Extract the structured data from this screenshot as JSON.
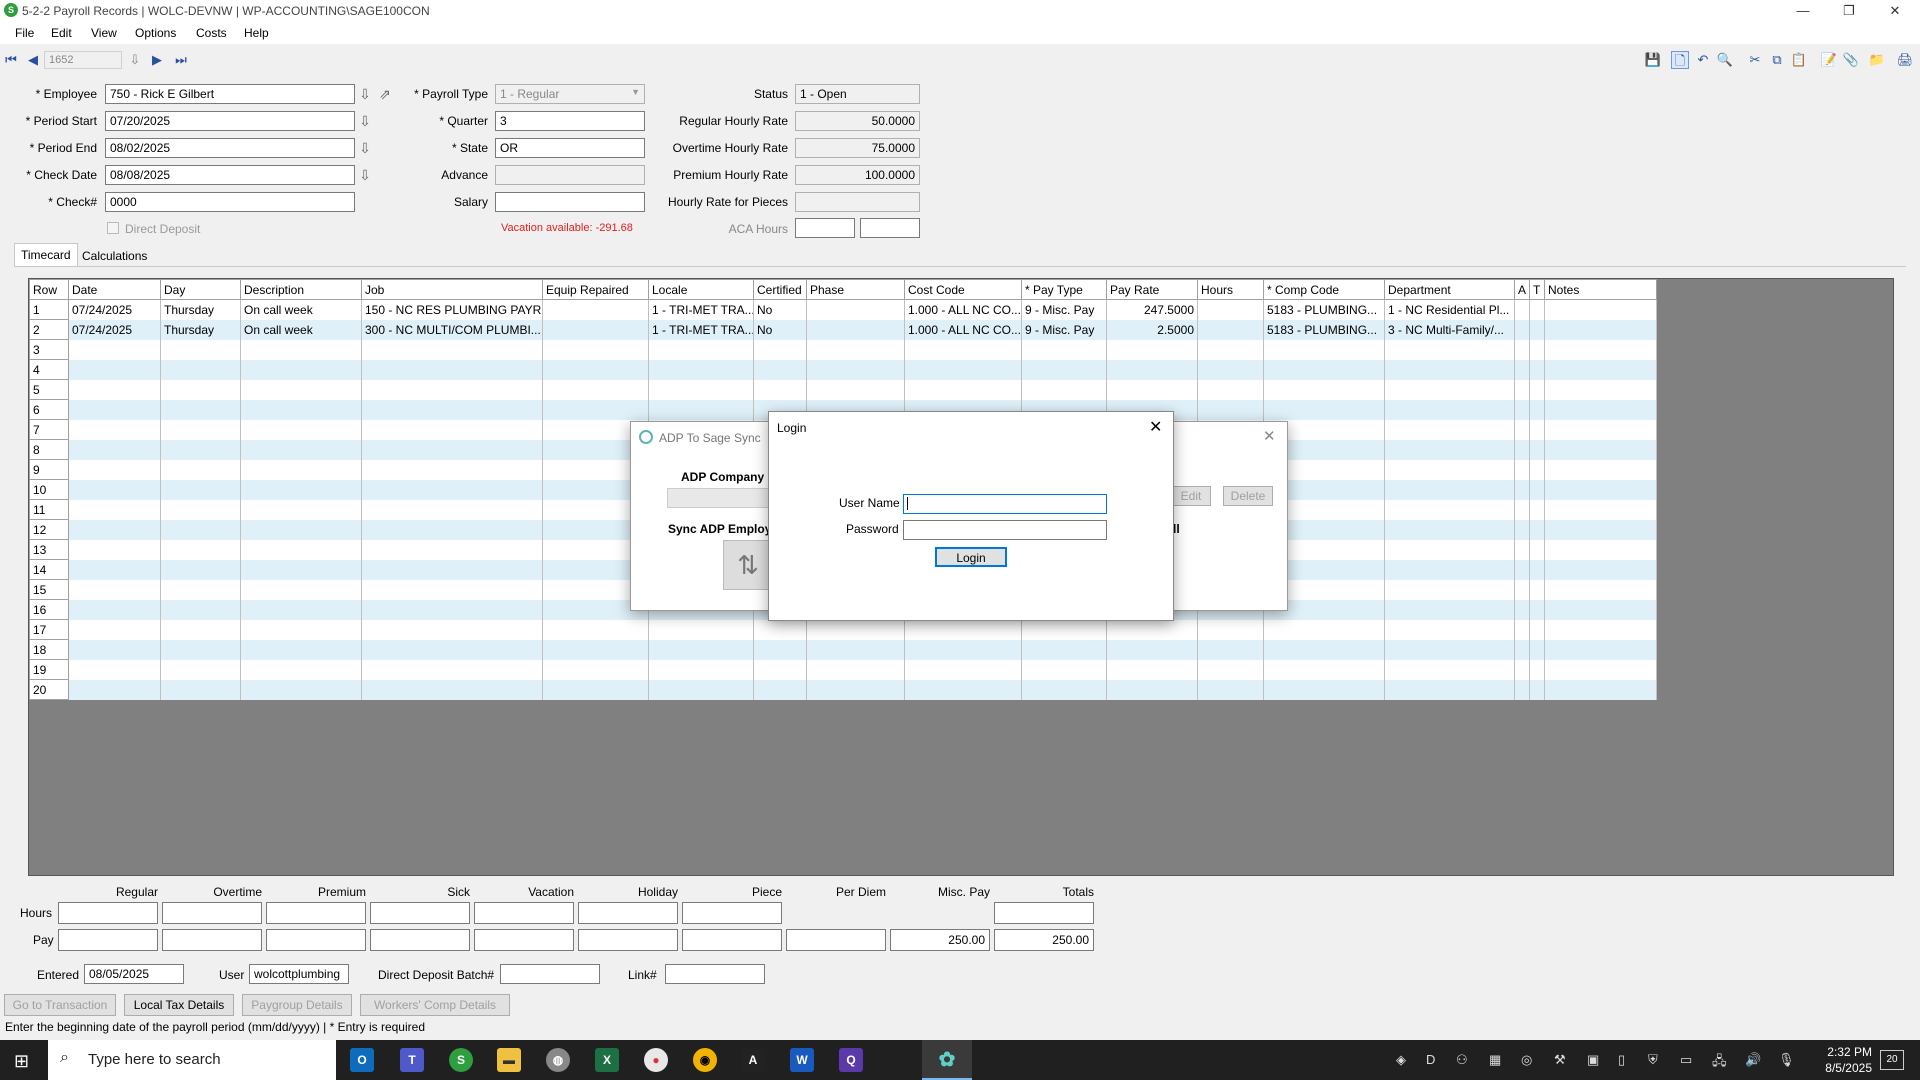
{
  "window": {
    "title": "5-2-2 Payroll Records  |  WOLC-DEVNW  |  WP-ACCOUNTING\\SAGE100CON",
    "minimize": "—",
    "maximize": "❐",
    "close": "✕"
  },
  "menu": [
    "File",
    "Edit",
    "View",
    "Options",
    "Costs",
    "Help"
  ],
  "record_number": "1652",
  "form": {
    "employee_label": "* Employee",
    "employee": "750 - Rick E Gilbert",
    "period_start_label": "* Period Start",
    "period_start": "07/20/2025",
    "period_end_label": "* Period End",
    "period_end": "08/02/2025",
    "check_date_label": "* Check Date",
    "check_date": "08/08/2025",
    "check_no_label": "* Check#",
    "check_no": "0000",
    "direct_deposit_label": "Direct Deposit",
    "payroll_type_label": "* Payroll Type",
    "payroll_type": "1 - Regular",
    "quarter_label": "* Quarter",
    "quarter": "3",
    "state_label": "* State",
    "state": "OR",
    "advance_label": "Advance",
    "advance": "",
    "salary_label": "Salary",
    "salary": "",
    "vacation_available": "Vacation available:  -291.68",
    "status_label": "Status",
    "status": "1 - Open",
    "regular_rate_label": "Regular Hourly Rate",
    "regular_rate": "50.0000",
    "overtime_rate_label": "Overtime Hourly Rate",
    "overtime_rate": "75.0000",
    "premium_rate_label": "Premium Hourly Rate",
    "premium_rate": "100.0000",
    "pieces_rate_label": "Hourly Rate for Pieces",
    "pieces_rate": "",
    "aca_hours_label": "ACA Hours"
  },
  "tabs": [
    "Timecard",
    "Calculations"
  ],
  "grid": {
    "columns": [
      "Row",
      "Date",
      "Day",
      "Description",
      "Job",
      "Equip Repaired",
      "Locale",
      "Certified",
      "Phase",
      "Cost Code",
      "* Pay Type",
      "Pay Rate",
      "Hours",
      "* Comp Code",
      "Department",
      "A",
      "T",
      "Notes"
    ],
    "rows": [
      [
        "1",
        "07/24/2025",
        "Thursday",
        "On call week",
        "150 - NC RES PLUMBING PAYR...",
        "",
        "1 - TRI-MET TRA...",
        "No",
        "",
        "1.000 - ALL NC CO...",
        "9 - Misc. Pay",
        "247.5000",
        "",
        "5183 - PLUMBING...",
        "1 - NC Residential Pl...",
        "",
        "",
        ""
      ],
      [
        "2",
        "07/24/2025",
        "Thursday",
        "On call week",
        "300 - NC MULTI/COM PLUMBI...",
        "",
        "1 - TRI-MET TRA...",
        "No",
        "",
        "1.000 - ALL NC CO...",
        "9 - Misc. Pay",
        "2.5000",
        "",
        "5183 - PLUMBING...",
        "3 - NC Multi-Family/...",
        "",
        "",
        ""
      ]
    ],
    "empty_rows": [
      "3",
      "4",
      "5",
      "6",
      "7",
      "8",
      "9",
      "10",
      "11",
      "12",
      "13",
      "14",
      "15",
      "16",
      "17",
      "18",
      "19",
      "20"
    ]
  },
  "summary": {
    "columns": [
      "Regular",
      "Overtime",
      "Premium",
      "Sick",
      "Vacation",
      "Holiday",
      "Piece",
      "Per Diem",
      "Misc. Pay",
      "Totals"
    ],
    "hours_label": "Hours",
    "pay_label": "Pay",
    "misc_pay": "250.00",
    "total_pay": "250.00"
  },
  "footer": {
    "entered_label": "Entered",
    "entered": "08/05/2025",
    "user_label": "User",
    "user": "wolcottplumbing",
    "dd_batch_label": "Direct Deposit Batch#",
    "dd_batch": "",
    "link_label": "Link#",
    "link": ""
  },
  "buttons": {
    "go_to_transaction": "Go to Transaction",
    "local_tax": "Local Tax Details",
    "paygroup": "Paygroup Details",
    "workers_comp": "Workers' Comp Details"
  },
  "status_bar": "Enter the beginning date of the payroll period (mm/dd/yyyy)  |  * Entry is required",
  "adp_dialog": {
    "title": "ADP To Sage Sync",
    "company_label": "ADP Company",
    "sync_label": "Sync ADP Employ",
    "edit": "Edit",
    "delete": "Delete"
  },
  "login_dialog": {
    "title": "Login",
    "username_label": "User Name",
    "password_label": "Password",
    "login_button": "Login",
    "username": "",
    "password": ""
  },
  "taskbar": {
    "search_placeholder": "Type here to search",
    "time": "2:32 PM",
    "date": "8/5/2025",
    "notifications": "20"
  },
  "colors": {
    "accent": "#0078d7",
    "warning_text": "#e02020",
    "grid_alt_row": "#dff0f8",
    "taskbar": "#202020"
  }
}
